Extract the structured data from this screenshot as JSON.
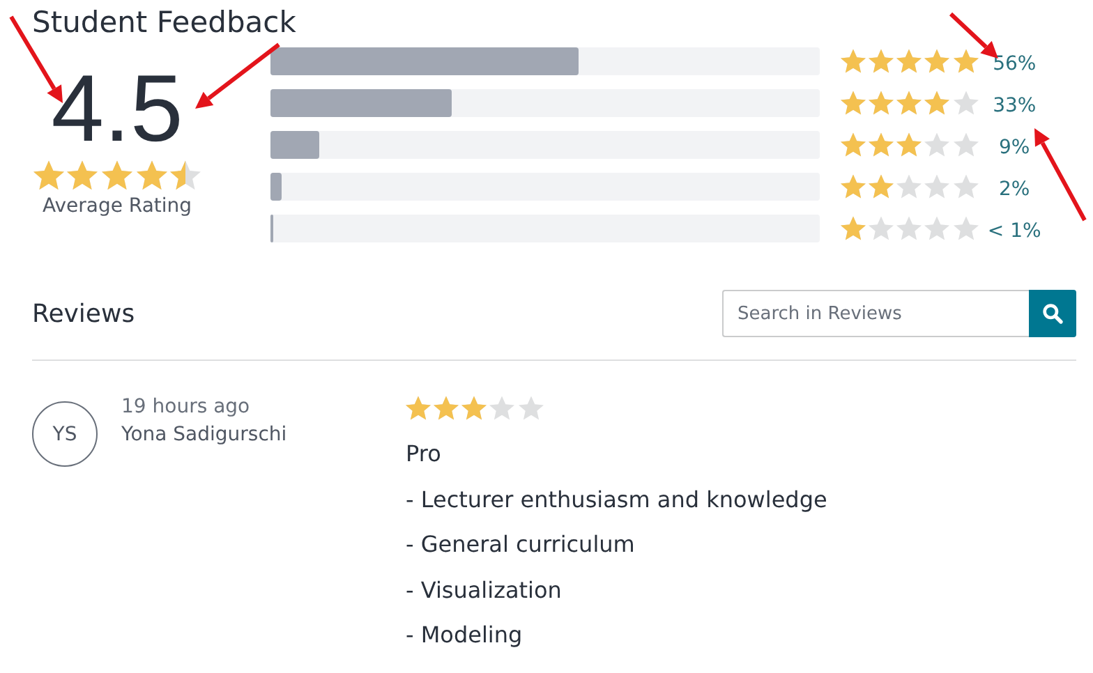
{
  "title": "Student Feedback",
  "summary": {
    "score": "4.5",
    "stars": 4.5,
    "label": "Average Rating"
  },
  "breakdown": [
    {
      "stars": 5,
      "level": 0.56,
      "percent": "56%"
    },
    {
      "stars": 4,
      "level": 0.33,
      "percent": "33%"
    },
    {
      "stars": 3,
      "level": 0.09,
      "percent": "9%"
    },
    {
      "stars": 2,
      "level": 0.02,
      "percent": "2%"
    },
    {
      "stars": 1,
      "level": 0.004,
      "percent": "< 1%"
    }
  ],
  "reviews_heading": "Reviews",
  "search": {
    "placeholder": "Search in Reviews"
  },
  "reviews": [
    {
      "initials": "YS",
      "time": "19 hours ago",
      "author": "Yona Sadigurschi",
      "stars": 3,
      "lines": [
        "Pro",
        "- Lecturer enthusiasm and knowledge",
        "- General curriculum",
        "- Visualization",
        "- Modeling"
      ]
    }
  ]
}
